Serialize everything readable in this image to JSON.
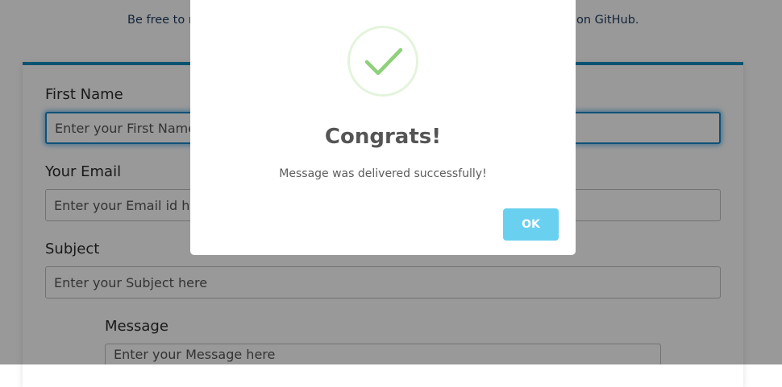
{
  "intro": {
    "text_left": "Be free to m",
    "text_right": "on GitHub."
  },
  "form": {
    "first_name": {
      "label": "First Name",
      "placeholder": "Enter your First Name here"
    },
    "email": {
      "label": "Your Email",
      "placeholder": "Enter your Email id here"
    },
    "subject": {
      "label": "Subject",
      "placeholder": "Enter your Subject here"
    },
    "message": {
      "label": "Message",
      "placeholder": "Enter your Message here"
    }
  },
  "dialog": {
    "icon": "checkmark-icon",
    "title": "Congrats!",
    "message": "Message was delivered successfully!",
    "ok_label": "OK",
    "colors": {
      "ok_button": "#69d0ef",
      "check": "#8fd07a",
      "accent_border": "#0d8bbd"
    }
  }
}
